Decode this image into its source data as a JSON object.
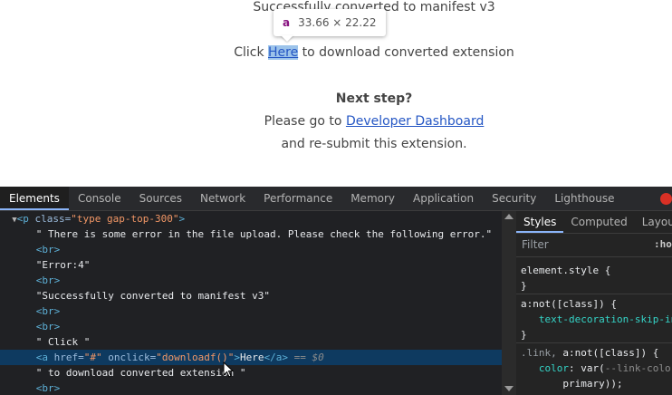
{
  "page": {
    "line_converted": "Successfully converted to manifest v3",
    "click_prefix": "Click ",
    "click_link": "Here",
    "click_suffix": " to download converted extension",
    "next_step": "Next step?",
    "goto_prefix": "Please go to ",
    "goto_link": "Developer Dashboard",
    "resubmit": "and re-submit this extension.",
    "tooltip": {
      "tag": "a",
      "size": "33.66 × 22.22"
    }
  },
  "devtools": {
    "tabs": [
      "Elements",
      "Console",
      "Sources",
      "Network",
      "Performance",
      "Memory",
      "Application",
      "Security",
      "Lighthouse"
    ],
    "active_tab": "Elements",
    "dom": {
      "p_open_tag": "<p",
      "p_attr_name": " class=",
      "p_attr_value": "\"type gap-top-300\"",
      "p_close": ">",
      "text_error_upload": "\" There is some error in the file upload. Please check the following error.\"",
      "br": "<br>",
      "text_error4": "\"Error:4\"",
      "text_success": "\"Successfully converted to manifest v3\"",
      "text_click": "\" Click \"",
      "a_open": "<a",
      "a_href_name": " href=",
      "a_href_value": "\"#\"",
      "a_onclick_name": " onclick=",
      "a_onclick_value": "\"downloadf()\"",
      "a_gt": ">",
      "a_text": "Here",
      "a_close": "</a>",
      "a_eq": " == ",
      "a_dollar": "$0",
      "text_to_download": "\" to download converted extension \""
    },
    "styles": {
      "tabs": [
        "Styles",
        "Computed",
        "Layout"
      ],
      "active_tab": "Styles",
      "filter_placeholder": "Filter",
      "hov": ":hov",
      "rule1_selector": "element.style {",
      "rule1_close": "}",
      "rule2_selector": "a:not([class]) {",
      "rule2_prop": "text-decoration-skip-ink",
      "rule2_close": "}",
      "rule3_sel_gray": ".link,",
      "rule3_sel_main": " a:not([class]) {",
      "rule3_prop": "color",
      "rule3_val": ": var(",
      "rule3_var": "--link-color-",
      "rule3_val2": "primary));",
      "rule3_close": "}"
    }
  }
}
